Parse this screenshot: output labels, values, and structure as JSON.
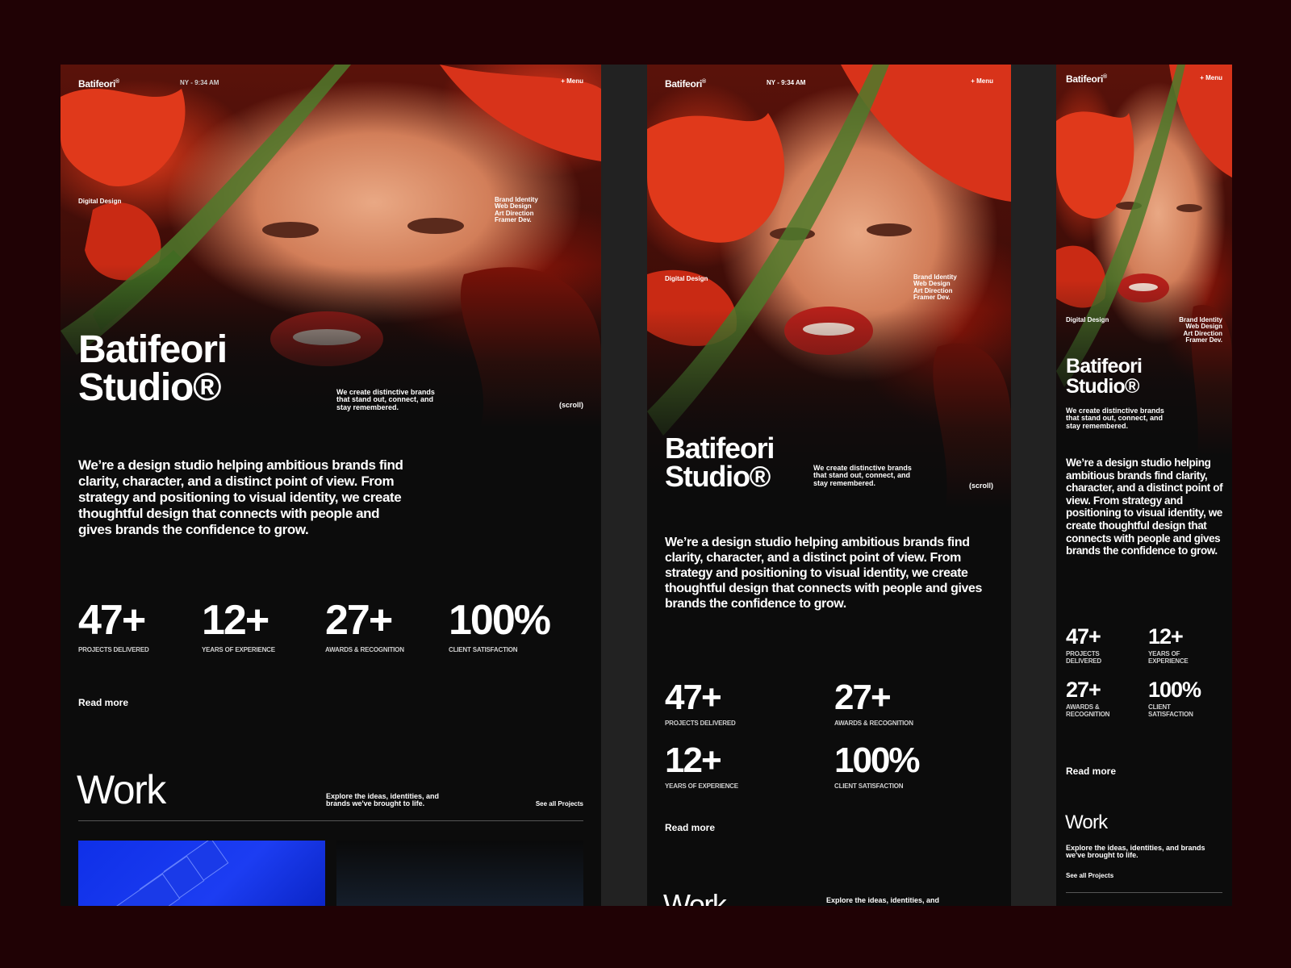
{
  "site": {
    "brand": "Batifeori",
    "brand_mark": "®",
    "clock": "NY - 9:34 AM",
    "menu": "+ Menu",
    "category": "Digital Design",
    "services": [
      "Brand Identity",
      "Web Design",
      "Art Direction",
      "Framer Dev."
    ],
    "title_line1": "Batifeori",
    "title_line2": "Studio®",
    "tagline": "We create distinctive brands that stand out, connect, and stay remembered.",
    "scroll": "(scroll)",
    "intro": "We’re a design studio helping ambitious brands find clarity, character, and a distinct point of view. From strategy and positioning to visual identity, we create thoughtful design that connects with people and gives brands the confidence to grow.",
    "stats": [
      {
        "value": "47+",
        "label": "PROJECTS DELIVERED"
      },
      {
        "value": "12+",
        "label": "YEARS OF EXPERIENCE"
      },
      {
        "value": "27+",
        "label": "AWARDS & RECOGNITION"
      },
      {
        "value": "100%",
        "label": "CLIENT SATISFACTION"
      }
    ],
    "read_more": "Read more",
    "work_title": "Work",
    "work_desc": "Explore the ideas, identities, and brands we've brought to life.",
    "see_all": "See all Projects",
    "tablet_work_partial": "Explore the ideas, identities, and"
  },
  "colors": {
    "page_background": "#200205",
    "panel_background": "#0c0c0c",
    "accent_red": "#d8331a",
    "project_blue": "#1c3df2"
  }
}
